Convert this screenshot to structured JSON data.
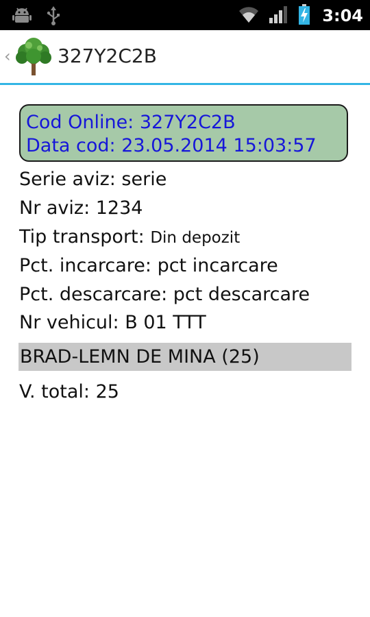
{
  "status_bar": {
    "time": "3:04",
    "icons": [
      "android-debug-icon",
      "usb-icon",
      "wifi-icon",
      "signal-icon",
      "battery-charging-icon"
    ]
  },
  "action_bar": {
    "title": "327Y2C2B",
    "up_caret": "‹",
    "logo_icon": "tree-icon"
  },
  "code_box": {
    "cod_online": "Cod Online: 327Y2C2B",
    "data_cod": "Data cod: 23.05.2014 15:03:57"
  },
  "details": {
    "serie_aviz": "Serie aviz: serie",
    "nr_aviz": "Nr aviz: 1234",
    "tip_transport_label": "Tip transport: ",
    "tip_transport_value": "Din depozit",
    "pct_incarcare": "Pct. incarcare: pct incarcare",
    "pct_descarcare": "Pct. descarcare: pct descarcare",
    "nr_vehicul": "Nr vehicul: B 01 TTT"
  },
  "items": [
    {
      "label": "BRAD-LEMN DE MINA (25)"
    }
  ],
  "total": "V. total: 25",
  "colors": {
    "accent": "#33b5e5",
    "code_box_bg": "#a6c9a8",
    "code_text": "#1616d9",
    "item_bg": "#c8c8c8"
  }
}
